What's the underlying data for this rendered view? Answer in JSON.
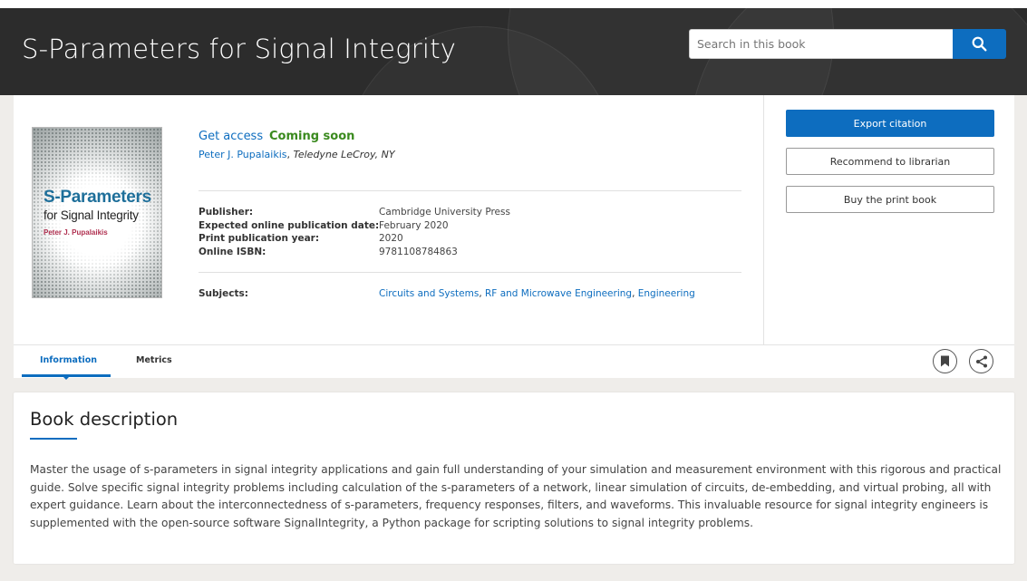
{
  "header": {
    "title": "S-Parameters for Signal Integrity",
    "search_placeholder": "Search in this book"
  },
  "cover": {
    "title_line1": "S-Parameters",
    "title_line2": "for Signal Integrity",
    "author": "Peter J. Pupalaikis"
  },
  "access": {
    "get_access": "Get access",
    "status": "Coming soon"
  },
  "author": {
    "name": "Peter J. Pupalaikis",
    "affiliation": "Teledyne LeCroy, NY"
  },
  "metadata": [
    {
      "label": "Publisher:",
      "value": "Cambridge University Press"
    },
    {
      "label": "Expected online publication date:",
      "value": "February 2020"
    },
    {
      "label": "Print publication year:",
      "value": "2020"
    },
    {
      "label": "Online ISBN:",
      "value": "9781108784863"
    }
  ],
  "subjects": {
    "label": "Subjects:",
    "items": [
      "Circuits and Systems",
      "RF and Microwave Engineering",
      "Engineering"
    ],
    "separator": ", "
  },
  "actions": {
    "export_citation": "Export citation",
    "recommend": "Recommend to librarian",
    "buy_print": "Buy the print book"
  },
  "tabs": [
    {
      "label": "Information",
      "active": true
    },
    {
      "label": "Metrics",
      "active": false
    }
  ],
  "description": {
    "heading": "Book description",
    "body": "Master the usage of s-parameters in signal integrity applications and gain full understanding of your simulation and measurement environment with this rigorous and practical guide. Solve specific signal integrity problems including calculation of the s-parameters of a network, linear simulation of circuits, de-embedding, and virtual probing, all with expert guidance. Learn about the interconnectedness of s-parameters, frequency responses, filters, and waveforms. This invaluable resource for signal integrity engineers is supplemented with the open-source software SignalIntegrity, a Python package for scripting solutions to signal integrity problems."
  },
  "icons": {
    "search": "search-icon",
    "bookmark": "bookmark-icon",
    "share": "share-icon"
  },
  "colors": {
    "accent": "#0d6dbf",
    "status_green": "#3a8a1e",
    "banner": "#2c2c2c"
  }
}
